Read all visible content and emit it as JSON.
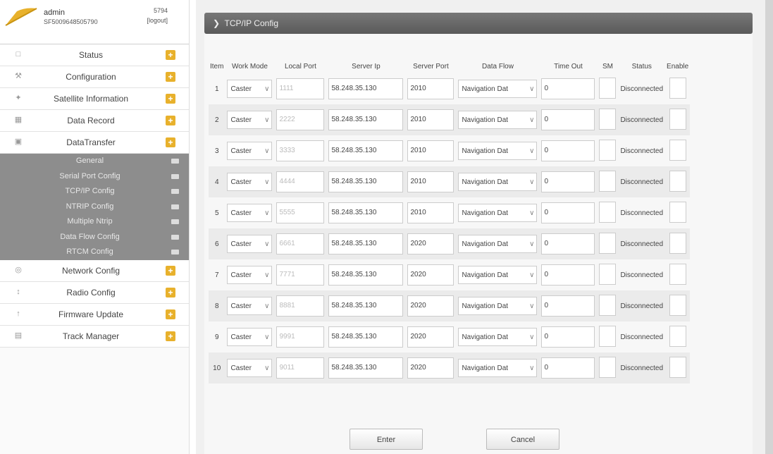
{
  "user": {
    "name": "admin",
    "serial": "SF5009648505790",
    "code": "5794",
    "logout": "[logout]"
  },
  "menu": {
    "items_top": [
      {
        "label": "Status",
        "icon": "monitor-icon"
      },
      {
        "label": "Configuration",
        "icon": "tools-icon"
      },
      {
        "label": "Satellite Information",
        "icon": "satellite-icon"
      },
      {
        "label": "Data Record",
        "icon": "calendar-icon"
      },
      {
        "label": "DataTransfer",
        "icon": "transfer-icon"
      }
    ],
    "sub_items": [
      "General",
      "Serial Port Config",
      "TCP/IP Config",
      "NTRIP Config",
      "Multiple Ntrip",
      "Data Flow Config",
      "RTCM Config"
    ],
    "items_bottom": [
      {
        "label": "Network Config",
        "icon": "network-icon"
      },
      {
        "label": "Radio Config",
        "icon": "radio-icon"
      },
      {
        "label": "Firmware Update",
        "icon": "firmware-icon"
      },
      {
        "label": "Track Manager",
        "icon": "track-icon"
      }
    ]
  },
  "panel": {
    "title": "TCP/IP Config"
  },
  "table": {
    "headers": [
      "Item",
      "Work Mode",
      "Local Port",
      "Server Ip",
      "Server Port",
      "Data Flow",
      "Time Out",
      "SM",
      "Status",
      "Enable"
    ],
    "rows": [
      {
        "item": "1",
        "mode": "Caster",
        "local": "1111",
        "ip": "58.248.35.130",
        "port": "2010",
        "flow": "Navigation Dat",
        "timeout": "0",
        "status": "Disconnected"
      },
      {
        "item": "2",
        "mode": "Caster",
        "local": "2222",
        "ip": "58.248.35.130",
        "port": "2010",
        "flow": "Navigation Dat",
        "timeout": "0",
        "status": "Disconnected"
      },
      {
        "item": "3",
        "mode": "Caster",
        "local": "3333",
        "ip": "58.248.35.130",
        "port": "2010",
        "flow": "Navigation Dat",
        "timeout": "0",
        "status": "Disconnected"
      },
      {
        "item": "4",
        "mode": "Caster",
        "local": "4444",
        "ip": "58.248.35.130",
        "port": "2010",
        "flow": "Navigation Dat",
        "timeout": "0",
        "status": "Disconnected"
      },
      {
        "item": "5",
        "mode": "Caster",
        "local": "5555",
        "ip": "58.248.35.130",
        "port": "2010",
        "flow": "Navigation Dat",
        "timeout": "0",
        "status": "Disconnected"
      },
      {
        "item": "6",
        "mode": "Caster",
        "local": "6661",
        "ip": "58.248.35.130",
        "port": "2020",
        "flow": "Navigation Dat",
        "timeout": "0",
        "status": "Disconnected"
      },
      {
        "item": "7",
        "mode": "Caster",
        "local": "7771",
        "ip": "58.248.35.130",
        "port": "2020",
        "flow": "Navigation Dat",
        "timeout": "0",
        "status": "Disconnected"
      },
      {
        "item": "8",
        "mode": "Caster",
        "local": "8881",
        "ip": "58.248.35.130",
        "port": "2020",
        "flow": "Navigation Dat",
        "timeout": "0",
        "status": "Disconnected"
      },
      {
        "item": "9",
        "mode": "Caster",
        "local": "9991",
        "ip": "58.248.35.130",
        "port": "2020",
        "flow": "Navigation Dat",
        "timeout": "0",
        "status": "Disconnected"
      },
      {
        "item": "10",
        "mode": "Caster",
        "local": "9011",
        "ip": "58.248.35.130",
        "port": "2020",
        "flow": "Navigation Dat",
        "timeout": "0",
        "status": "Disconnected"
      }
    ]
  },
  "buttons": {
    "enter": "Enter",
    "cancel": "Cancel"
  },
  "colors": {
    "accent": "#e8b12c",
    "submenu_bg": "#8d8d8d",
    "header_bg": "#666666"
  }
}
